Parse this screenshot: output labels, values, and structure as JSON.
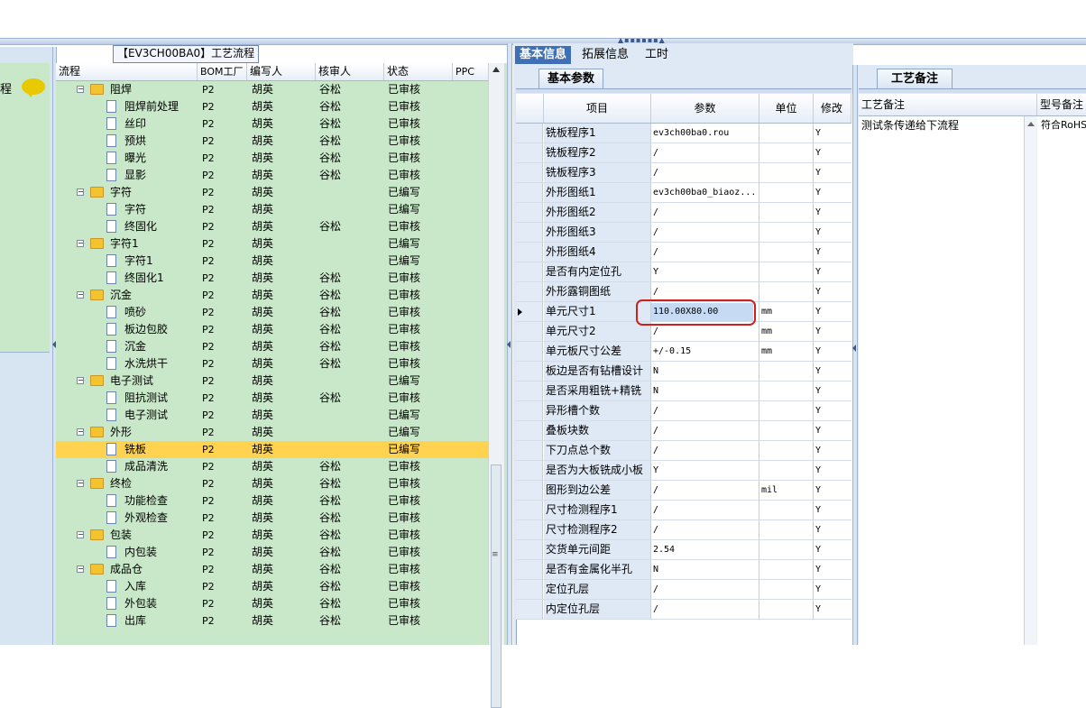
{
  "left": {
    "fragment_char": "程"
  },
  "process": {
    "title_tag": "【EV3CH00BA0】工艺流程",
    "headers": {
      "flow": "流程",
      "bom": "BOM工厂",
      "author": "编写人",
      "reviewer": "核审人",
      "status": "状态",
      "ppc": "PPC"
    },
    "rows": [
      {
        "name": "阻焊",
        "level": 0,
        "bom": "P2",
        "author": "胡英",
        "reviewer": "谷松",
        "status": "已审核",
        "selected": false
      },
      {
        "name": "阻焊前处理",
        "level": 1,
        "bom": "P2",
        "author": "胡英",
        "reviewer": "谷松",
        "status": "已审核",
        "selected": false
      },
      {
        "name": "丝印",
        "level": 1,
        "bom": "P2",
        "author": "胡英",
        "reviewer": "谷松",
        "status": "已审核",
        "selected": false
      },
      {
        "name": "预烘",
        "level": 1,
        "bom": "P2",
        "author": "胡英",
        "reviewer": "谷松",
        "status": "已审核",
        "selected": false
      },
      {
        "name": "曝光",
        "level": 1,
        "bom": "P2",
        "author": "胡英",
        "reviewer": "谷松",
        "status": "已审核",
        "selected": false
      },
      {
        "name": "显影",
        "level": 1,
        "bom": "P2",
        "author": "胡英",
        "reviewer": "谷松",
        "status": "已审核",
        "selected": false
      },
      {
        "name": "字符",
        "level": 0,
        "bom": "P2",
        "author": "胡英",
        "reviewer": "",
        "status": "已编写",
        "selected": false
      },
      {
        "name": "字符",
        "level": 1,
        "bom": "P2",
        "author": "胡英",
        "reviewer": "",
        "status": "已编写",
        "selected": false
      },
      {
        "name": "终固化",
        "level": 1,
        "bom": "P2",
        "author": "胡英",
        "reviewer": "谷松",
        "status": "已审核",
        "selected": false
      },
      {
        "name": "字符1",
        "level": 0,
        "bom": "P2",
        "author": "胡英",
        "reviewer": "",
        "status": "已编写",
        "selected": false
      },
      {
        "name": "字符1",
        "level": 1,
        "bom": "P2",
        "author": "胡英",
        "reviewer": "",
        "status": "已编写",
        "selected": false
      },
      {
        "name": "终固化1",
        "level": 1,
        "bom": "P2",
        "author": "胡英",
        "reviewer": "谷松",
        "status": "已审核",
        "selected": false
      },
      {
        "name": "沉金",
        "level": 0,
        "bom": "P2",
        "author": "胡英",
        "reviewer": "谷松",
        "status": "已审核",
        "selected": false
      },
      {
        "name": "喷砂",
        "level": 1,
        "bom": "P2",
        "author": "胡英",
        "reviewer": "谷松",
        "status": "已审核",
        "selected": false
      },
      {
        "name": "板边包胶",
        "level": 1,
        "bom": "P2",
        "author": "胡英",
        "reviewer": "谷松",
        "status": "已审核",
        "selected": false
      },
      {
        "name": "沉金",
        "level": 1,
        "bom": "P2",
        "author": "胡英",
        "reviewer": "谷松",
        "status": "已审核",
        "selected": false
      },
      {
        "name": "水洗烘干",
        "level": 1,
        "bom": "P2",
        "author": "胡英",
        "reviewer": "谷松",
        "status": "已审核",
        "selected": false
      },
      {
        "name": "电子测试",
        "level": 0,
        "bom": "P2",
        "author": "胡英",
        "reviewer": "",
        "status": "已编写",
        "selected": false
      },
      {
        "name": "阻抗测试",
        "level": 1,
        "bom": "P2",
        "author": "胡英",
        "reviewer": "谷松",
        "status": "已审核",
        "selected": false
      },
      {
        "name": "电子测试",
        "level": 1,
        "bom": "P2",
        "author": "胡英",
        "reviewer": "",
        "status": "已编写",
        "selected": false
      },
      {
        "name": "外形",
        "level": 0,
        "bom": "P2",
        "author": "胡英",
        "reviewer": "",
        "status": "已编写",
        "selected": false
      },
      {
        "name": "铣板",
        "level": 1,
        "bom": "P2",
        "author": "胡英",
        "reviewer": "",
        "status": "已编写",
        "selected": true
      },
      {
        "name": "成品清洗",
        "level": 1,
        "bom": "P2",
        "author": "胡英",
        "reviewer": "谷松",
        "status": "已审核",
        "selected": false
      },
      {
        "name": "终检",
        "level": 0,
        "bom": "P2",
        "author": "胡英",
        "reviewer": "谷松",
        "status": "已审核",
        "selected": false
      },
      {
        "name": "功能检查",
        "level": 1,
        "bom": "P2",
        "author": "胡英",
        "reviewer": "谷松",
        "status": "已审核",
        "selected": false
      },
      {
        "name": "外观检查",
        "level": 1,
        "bom": "P2",
        "author": "胡英",
        "reviewer": "谷松",
        "status": "已审核",
        "selected": false
      },
      {
        "name": "包装",
        "level": 0,
        "bom": "P2",
        "author": "胡英",
        "reviewer": "谷松",
        "status": "已审核",
        "selected": false
      },
      {
        "name": "内包装",
        "level": 1,
        "bom": "P2",
        "author": "胡英",
        "reviewer": "谷松",
        "status": "已审核",
        "selected": false
      },
      {
        "name": "成品仓",
        "level": 0,
        "bom": "P2",
        "author": "胡英",
        "reviewer": "谷松",
        "status": "已审核",
        "selected": false
      },
      {
        "name": "入库",
        "level": 1,
        "bom": "P2",
        "author": "胡英",
        "reviewer": "谷松",
        "status": "已审核",
        "selected": false
      },
      {
        "name": "外包装",
        "level": 1,
        "bom": "P2",
        "author": "胡英",
        "reviewer": "谷松",
        "status": "已审核",
        "selected": false
      },
      {
        "name": "出库",
        "level": 1,
        "bom": "P2",
        "author": "胡英",
        "reviewer": "谷松",
        "status": "已审核",
        "selected": false
      }
    ]
  },
  "detail": {
    "tabs": [
      "基本信息",
      "拓展信息",
      "工时"
    ],
    "active_tab": "基本信息",
    "subtab": "基本参数",
    "headers": {
      "item": "项目",
      "param": "参数",
      "unit": "单位",
      "mod": "修改"
    },
    "rows": [
      {
        "item": "铣板程序1",
        "param": "ev3ch00ba0.rou",
        "unit": "",
        "mod": "Y"
      },
      {
        "item": "铣板程序2",
        "param": "/",
        "unit": "",
        "mod": "Y"
      },
      {
        "item": "铣板程序3",
        "param": "/",
        "unit": "",
        "mod": "Y"
      },
      {
        "item": "外形图纸1",
        "param": "ev3ch00ba0_biaoz...",
        "unit": "",
        "mod": "Y"
      },
      {
        "item": "外形图纸2",
        "param": "/",
        "unit": "",
        "mod": "Y"
      },
      {
        "item": "外形图纸3",
        "param": "/",
        "unit": "",
        "mod": "Y"
      },
      {
        "item": "外形图纸4",
        "param": "/",
        "unit": "",
        "mod": "Y"
      },
      {
        "item": "是否有内定位孔",
        "param": "Y",
        "unit": "",
        "mod": "Y"
      },
      {
        "item": "外形露铜图纸",
        "param": "/",
        "unit": "",
        "mod": "Y"
      },
      {
        "item": "单元尺寸1",
        "param": "110.00X80.00",
        "unit": "mm",
        "mod": "Y"
      },
      {
        "item": "单元尺寸2",
        "param": "/",
        "unit": "mm",
        "mod": "Y"
      },
      {
        "item": "单元板尺寸公差",
        "param": "+/-0.15",
        "unit": "mm",
        "mod": "Y"
      },
      {
        "item": "板边是否有钻槽设计",
        "param": "N",
        "unit": "",
        "mod": "Y"
      },
      {
        "item": "是否采用粗铣+精铣",
        "param": "N",
        "unit": "",
        "mod": "Y"
      },
      {
        "item": "异形槽个数",
        "param": "/",
        "unit": "",
        "mod": "Y"
      },
      {
        "item": "叠板块数",
        "param": "/",
        "unit": "",
        "mod": "Y"
      },
      {
        "item": "下刀点总个数",
        "param": "/",
        "unit": "",
        "mod": "Y"
      },
      {
        "item": "是否为大板铣成小板",
        "param": "Y",
        "unit": "",
        "mod": "Y"
      },
      {
        "item": "图形到边公差",
        "param": "/",
        "unit": "mil",
        "mod": "Y"
      },
      {
        "item": "尺寸检测程序1",
        "param": "/",
        "unit": "",
        "mod": "Y"
      },
      {
        "item": "尺寸检测程序2",
        "param": "/",
        "unit": "",
        "mod": "Y"
      },
      {
        "item": "交货单元间距",
        "param": "2.54",
        "unit": "",
        "mod": "Y"
      },
      {
        "item": "是否有金属化半孔",
        "param": "N",
        "unit": "",
        "mod": "Y"
      },
      {
        "item": "定位孔层",
        "param": "/",
        "unit": "",
        "mod": "Y"
      },
      {
        "item": "内定位孔层",
        "param": "/",
        "unit": "",
        "mod": "Y"
      }
    ]
  },
  "remarks": {
    "tab": "工艺备注",
    "headers": {
      "remark": "工艺备注",
      "model_remark": "型号备注"
    },
    "remark_text": "测试条传递给下流程",
    "model_remark_text": "符合RoHS"
  },
  "colors": {
    "tree_bg": "#c9e7c9",
    "selected_row": "#ffd34f",
    "tab_active": "#3f6fb5",
    "highlight_border": "#d0201c"
  }
}
